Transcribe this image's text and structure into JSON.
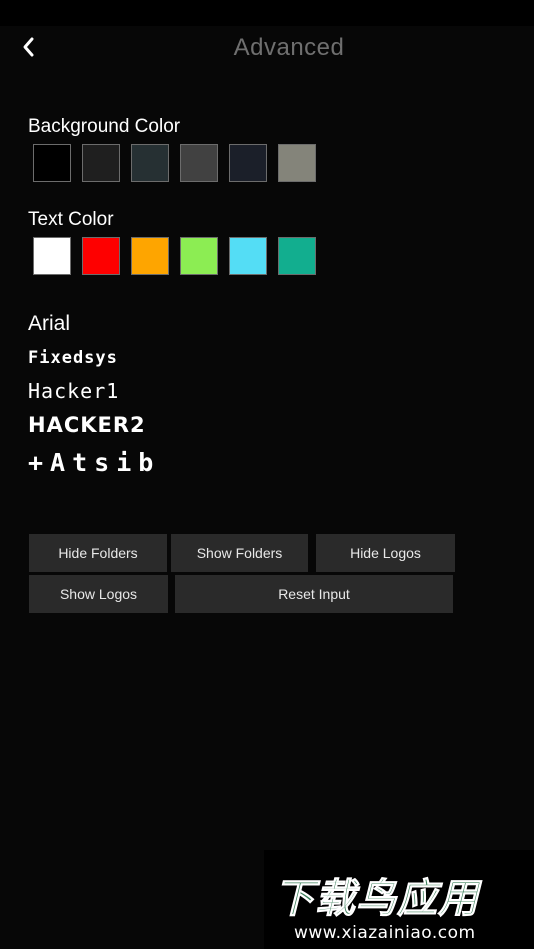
{
  "header": {
    "title": "Advanced",
    "back_icon": "chevron-left-icon"
  },
  "background_color": {
    "label": "Background Color",
    "swatches": [
      "#000000",
      "#1f1f1f",
      "#263033",
      "#414141",
      "#1b1f29",
      "#84847a"
    ]
  },
  "text_color": {
    "label": "Text Color",
    "swatches": [
      "#ffffff",
      "#fe0000",
      "#fea500",
      "#8ced53",
      "#54ddf5",
      "#12ae8f"
    ]
  },
  "fonts": {
    "arial": "Arial",
    "fixedsys": "Fixedsys",
    "hacker1": "Hacker1",
    "hacker2": "HACKER2",
    "glyph": "+Atsib"
  },
  "buttons": {
    "hide_folders": "Hide Folders",
    "show_folders": "Show Folders",
    "hide_logos": "Hide Logos",
    "show_logos": "Show Logos",
    "reset_input": "Reset Input"
  },
  "watermark": {
    "logo": "下载鸟应用",
    "url": "www.xiazainiao.com"
  }
}
